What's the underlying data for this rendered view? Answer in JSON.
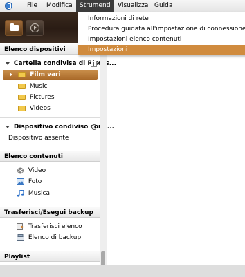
{
  "menubar": {
    "items": [
      {
        "label": "File"
      },
      {
        "label": "Modifica"
      },
      {
        "label": "Strumenti"
      },
      {
        "label": "Visualizza"
      },
      {
        "label": "Guida"
      }
    ],
    "active_index": 2
  },
  "dropdown": {
    "items": [
      {
        "label": "Informazioni di rete"
      },
      {
        "label": "Procedura guidata all'impostazione di connessione"
      },
      {
        "label": "Impostazioni elenco contenuti"
      },
      {
        "label": "Impostazioni"
      }
    ],
    "highlighted_index": 3,
    "highlight_color": "#d08b3e"
  },
  "sidebar": {
    "devices_header": "Elenco dispositivi",
    "shared_folder": "Cartella condivisa di Risors...",
    "folders": [
      "Film vari",
      "Music",
      "Pictures",
      "Videos"
    ],
    "selected_folder_index": 0,
    "shared_device": "Dispositivo condiviso conn...",
    "device_status": "Dispositivo assente",
    "content_header": "Elenco contenuti",
    "content_items": [
      "Video",
      "Foto",
      "Musica"
    ],
    "transfer_header": "Trasferisci/Esegui backup",
    "transfer_items": [
      "Trasferisci elenco",
      "Elenco di backup"
    ],
    "playlist_header": "Playlist"
  },
  "colors": {
    "selection": "#b8742f",
    "banner": "#2e2018"
  },
  "icons": {
    "app": "app-logo-icon",
    "folder": "folder-icon",
    "play": "play-circle-icon",
    "video": "film-reel-icon",
    "photo": "photo-icon",
    "music": "music-note-icon",
    "transfer": "transfer-list-icon",
    "backup": "backup-list-icon",
    "refresh": "refresh-icon",
    "add": "plus-icon"
  }
}
